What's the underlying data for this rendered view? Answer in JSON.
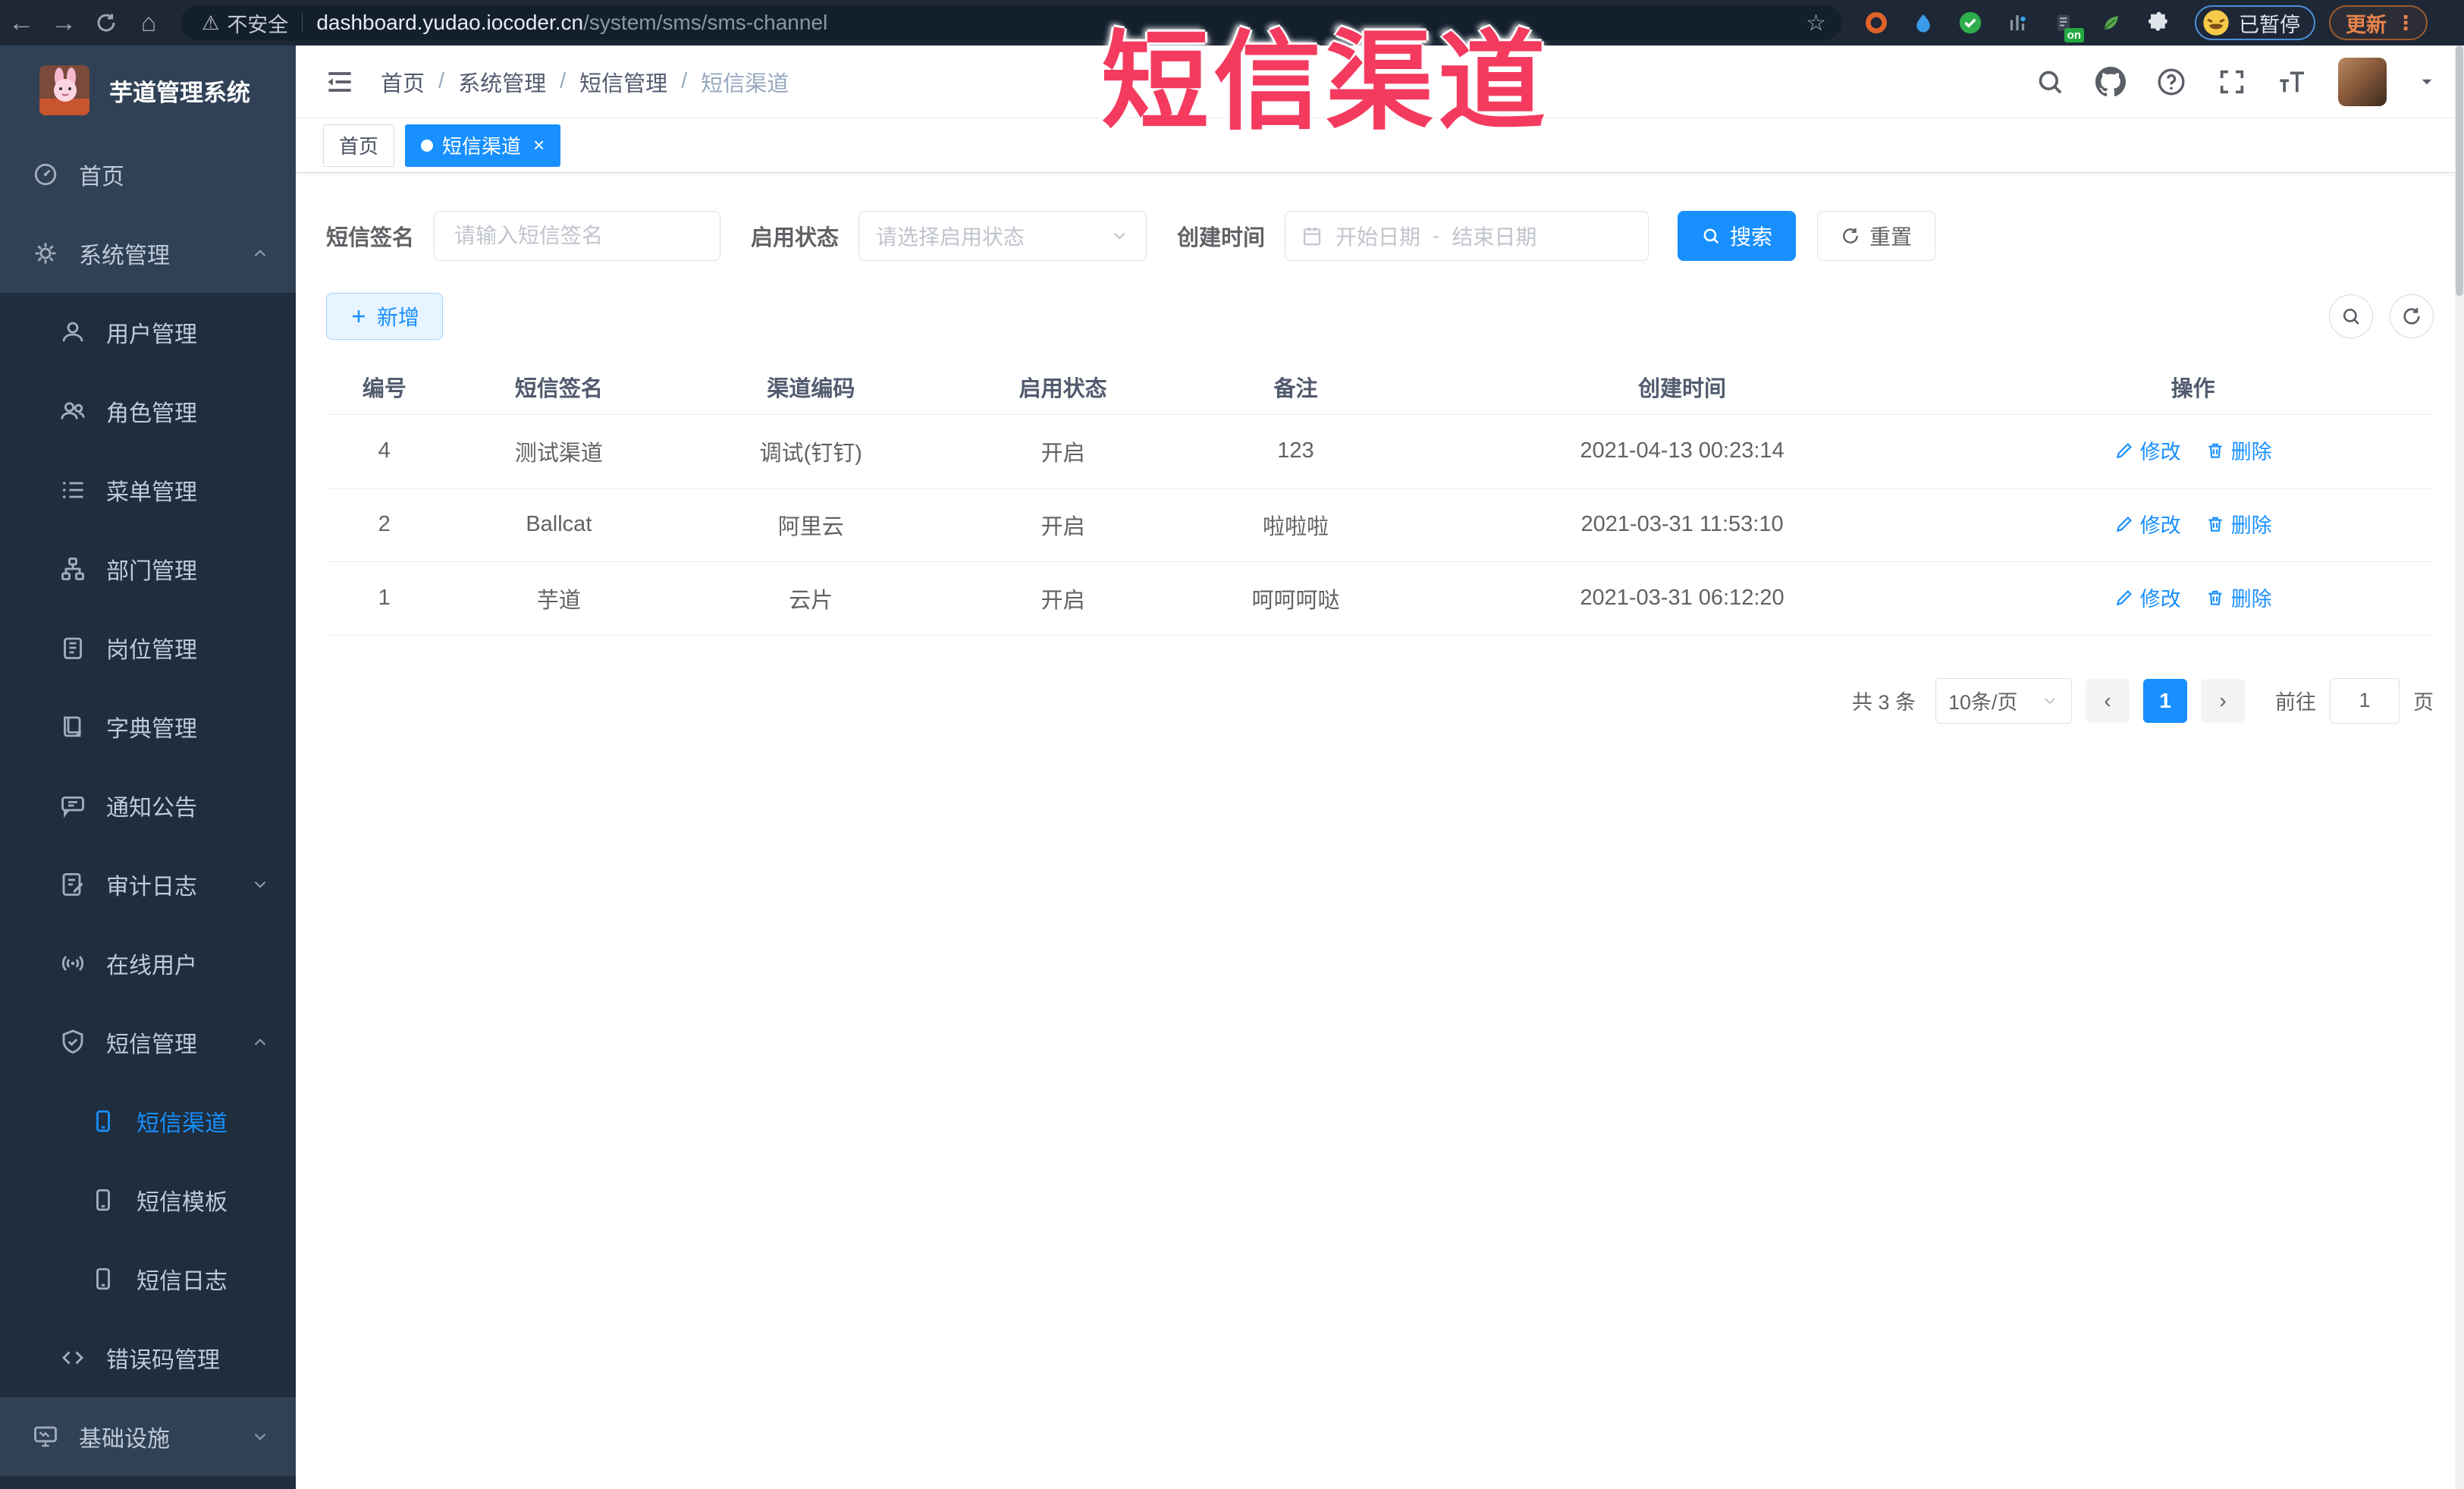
{
  "colors": {
    "accent": "#1890ff",
    "overlay_red": "#f43b5f",
    "sidebar_bg": "#304156",
    "sidebar_sub_bg": "#1f2d3d",
    "sidebar_text": "#bfcbd9"
  },
  "overlay_title": "短信渠道",
  "browser": {
    "security_label": "不安全",
    "url_host": "dashboard.yudao.iocoder.cn",
    "url_path": "/system/sms/sms-channel",
    "extension_badge": "on",
    "paused_badge": "已暂停",
    "update_button": "更新"
  },
  "sidebar": {
    "app_title": "芋道管理系统",
    "items": [
      {
        "key": "home",
        "label": "首页",
        "icon": "dashboard-icon",
        "level": 1,
        "section": "light"
      },
      {
        "key": "system-management",
        "label": "系统管理",
        "icon": "gear-icon",
        "level": 1,
        "section": "light",
        "chevron": "up"
      },
      {
        "key": "user-management",
        "label": "用户管理",
        "icon": "user-icon",
        "level": 2
      },
      {
        "key": "role-management",
        "label": "角色管理",
        "icon": "users-icon",
        "level": 2
      },
      {
        "key": "menu-management",
        "label": "菜单管理",
        "icon": "menu-list-icon",
        "level": 2
      },
      {
        "key": "dept-management",
        "label": "部门管理",
        "icon": "org-tree-icon",
        "level": 2
      },
      {
        "key": "post-management",
        "label": "岗位管理",
        "icon": "badge-icon",
        "level": 2
      },
      {
        "key": "dict-management",
        "label": "字典管理",
        "icon": "dict-icon",
        "level": 2
      },
      {
        "key": "notice-announcement",
        "label": "通知公告",
        "icon": "announcement-icon",
        "level": 2
      },
      {
        "key": "audit-log",
        "label": "审计日志",
        "icon": "log-icon",
        "level": 2,
        "chevron": "down"
      },
      {
        "key": "online-users",
        "label": "在线用户",
        "icon": "online-icon",
        "level": 2
      },
      {
        "key": "sms-management",
        "label": "短信管理",
        "icon": "sms-shield-icon",
        "level": 2,
        "chevron": "up"
      },
      {
        "key": "sms-channel",
        "label": "短信渠道",
        "icon": "phone-icon",
        "level": 3,
        "active": true
      },
      {
        "key": "sms-template",
        "label": "短信模板",
        "icon": "phone-icon",
        "level": 3
      },
      {
        "key": "sms-log",
        "label": "短信日志",
        "icon": "phone-icon",
        "level": 3
      },
      {
        "key": "error-code-management",
        "label": "错误码管理",
        "icon": "code-icon",
        "level": 2
      },
      {
        "key": "infrastructure",
        "label": "基础设施",
        "icon": "monitor-icon",
        "level": 1,
        "section": "light",
        "chevron": "down"
      }
    ]
  },
  "header": {
    "breadcrumb": [
      "首页",
      "系统管理",
      "短信管理",
      "短信渠道"
    ]
  },
  "tabs": [
    {
      "label": "首页",
      "active": false
    },
    {
      "label": "短信渠道",
      "active": true,
      "closable": true
    }
  ],
  "filter": {
    "signature_label": "短信签名",
    "signature_placeholder": "请输入短信签名",
    "status_label": "启用状态",
    "status_placeholder": "请选择启用状态",
    "created_label": "创建时间",
    "date_start_placeholder": "开始日期",
    "date_separator": "-",
    "date_end_placeholder": "结束日期",
    "search_button": "搜索",
    "reset_button": "重置"
  },
  "toolbar": {
    "add_button": "新增"
  },
  "table": {
    "columns": [
      "编号",
      "短信签名",
      "渠道编码",
      "启用状态",
      "备注",
      "创建时间",
      "操作"
    ],
    "rows": [
      {
        "cells": [
          "4",
          "测试渠道",
          "调试(钉钉)",
          "开启",
          "123",
          "2021-04-13 00:23:14"
        ]
      },
      {
        "cells": [
          "2",
          "Ballcat",
          "阿里云",
          "开启",
          "啦啦啦",
          "2021-03-31 11:53:10"
        ]
      },
      {
        "cells": [
          "1",
          "芋道",
          "云片",
          "开启",
          "呵呵呵哒",
          "2021-03-31 06:12:20"
        ]
      }
    ],
    "edit_label": "修改",
    "delete_label": "删除"
  },
  "pagination": {
    "total_text": "共 3 条",
    "page_size": "10条/页",
    "current_page": "1",
    "goto_label": "前往",
    "goto_value": "1",
    "page_suffix": "页"
  }
}
